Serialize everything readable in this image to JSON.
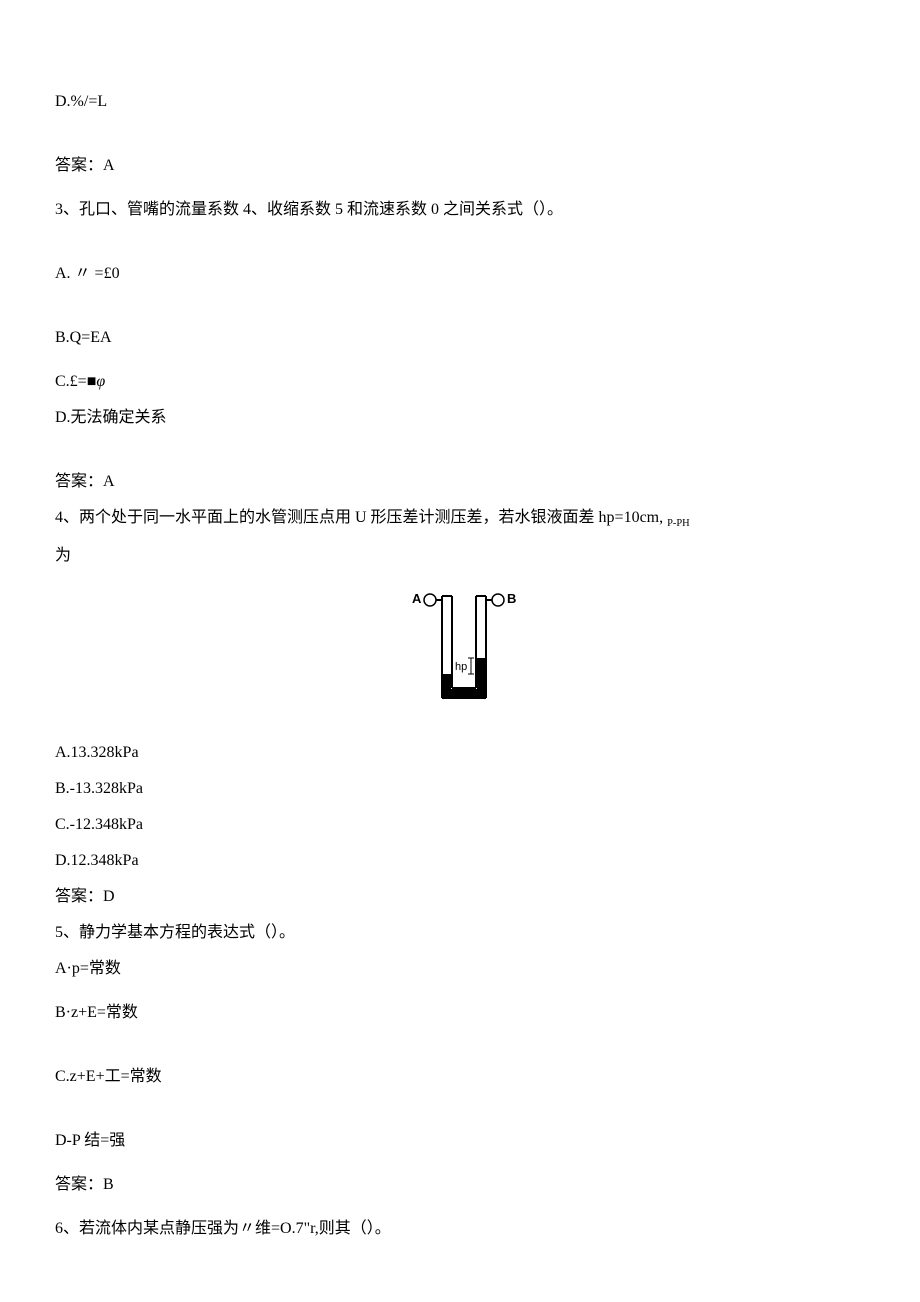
{
  "lines": {
    "opt_d_prev": "D.%/=L",
    "ans2": "答案：A",
    "q3": "3、孔口、管嘴的流量系数 4、收缩系数 5 和流速系数 0 之间关系式（）。",
    "q3a": "A. 〃 =£0",
    "q3b": "B.Q=EA",
    "q3c_pre": "C.£=■",
    "q3c_phi": "φ",
    "q3d": "D.无法确定关系",
    "ans3": "答案：A",
    "q4_part1": "4、两个处于同一水平面上的水管测压点用 U 形压差计测压差，若水银液面差 hp=10cm,   ",
    "q4_sub": "P-PH",
    "q4_part2": "为",
    "fig_a": "A",
    "fig_b": "B",
    "fig_hp": "hp",
    "q4a": "A.13.328kPa",
    "q4b": "B.-13.328kPa",
    "q4c": "C.-12.348kPa",
    "q4d": "D.12.348kPa",
    "ans4": "答案：D",
    "q5": "5、静力学基本方程的表达式（）。",
    "q5a": "A·p=常数",
    "q5b": "B·z+E=常数",
    "q5c": "C.z+E+工=常数",
    "q5d": "D-P 结=强",
    "ans5": "答案：B",
    "q6": "6、若流体内某点静压强为〃维=O.7\"r,则其（）。"
  }
}
